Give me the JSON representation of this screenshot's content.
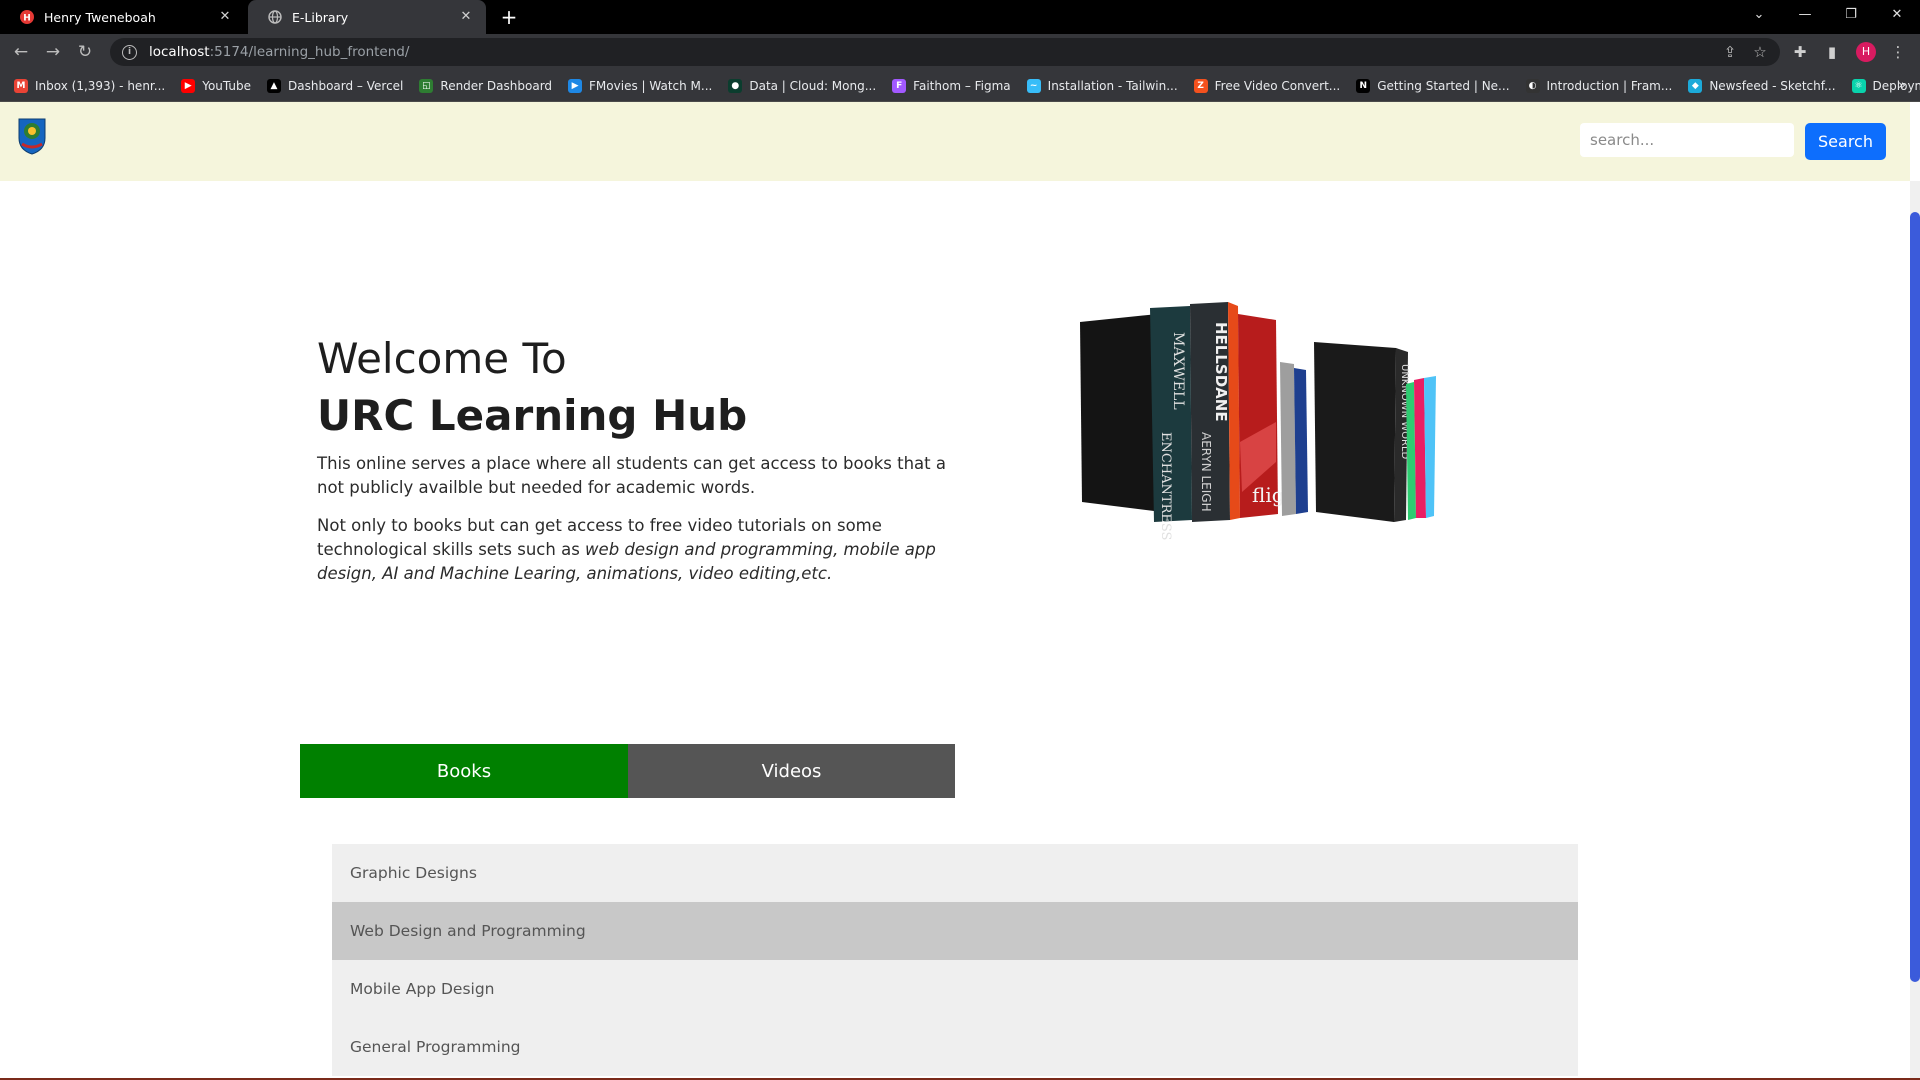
{
  "browser": {
    "tabs": [
      {
        "title": "Henry Tweneboah",
        "active": false,
        "favicon": "h-badge-icon"
      },
      {
        "title": "E-Library",
        "active": true,
        "favicon": "globe-icon"
      }
    ],
    "url_host": "localhost",
    "url_path": ":5174/learning_hub_frontend/",
    "profile_initial": "H",
    "bookmarks": [
      {
        "label": "Inbox (1,393) - henr...",
        "icon": "gmail-icon",
        "color": "#ea4335",
        "glyph": "M"
      },
      {
        "label": "YouTube",
        "icon": "youtube-icon",
        "color": "#ff0000",
        "glyph": "▶"
      },
      {
        "label": "Dashboard – Vercel",
        "icon": "vercel-icon",
        "color": "#000000",
        "glyph": "▲"
      },
      {
        "label": "Render Dashboard",
        "icon": "render-icon",
        "color": "#2e7d32",
        "glyph": "◱"
      },
      {
        "label": "FMovies | Watch M...",
        "icon": "fmovies-icon",
        "color": "#1e88e5",
        "glyph": "▶"
      },
      {
        "label": "Data | Cloud: Mong...",
        "icon": "mongodb-icon",
        "color": "#0b3d2e",
        "glyph": "●"
      },
      {
        "label": "Faithom – Figma",
        "icon": "figma-icon",
        "color": "#a259ff",
        "glyph": "F"
      },
      {
        "label": "Installation - Tailwin...",
        "icon": "tailwind-icon",
        "color": "#38bdf8",
        "glyph": "~"
      },
      {
        "label": "Free Video Convert...",
        "icon": "converter-icon",
        "color": "#f4511e",
        "glyph": "Z"
      },
      {
        "label": "Getting Started | Ne...",
        "icon": "nextjs-icon",
        "color": "#000000",
        "glyph": "N"
      },
      {
        "label": "Introduction | Fram...",
        "icon": "framer-icon",
        "color": "#333333",
        "glyph": "◐"
      },
      {
        "label": "Newsfeed - Sketchf...",
        "icon": "sketchfab-icon",
        "color": "#1caad9",
        "glyph": "◆"
      },
      {
        "label": "Deployment | Creat...",
        "icon": "react-icon",
        "color": "#09d3ac",
        "glyph": "⚛"
      }
    ]
  },
  "header": {
    "search_placeholder": "search...",
    "search_button": "Search"
  },
  "hero": {
    "welcome": "Welcome To",
    "title": "URC Learning Hub",
    "paragraph1": "This online serves a place where all students can get access to books that a not publicly availble but needed for academic words.",
    "paragraph2_plain": "Not only to books but can get access to free video tutorials on some technological skills sets such as ",
    "paragraph2_italic": "web design and programming, mobile app design, AI and Machine Learing, animations, video editing,etc."
  },
  "tabs": {
    "books": "Books",
    "videos": "Videos",
    "active_color": "#008000",
    "inactive_color": "#555555"
  },
  "categories": [
    {
      "label": "Graphic Designs"
    },
    {
      "label": "Web Design and Programming"
    },
    {
      "label": "Mobile App Design"
    },
    {
      "label": "General Programming"
    }
  ],
  "colors": {
    "header_bg": "#f5f5dc",
    "search_button": "#0d6efd"
  }
}
